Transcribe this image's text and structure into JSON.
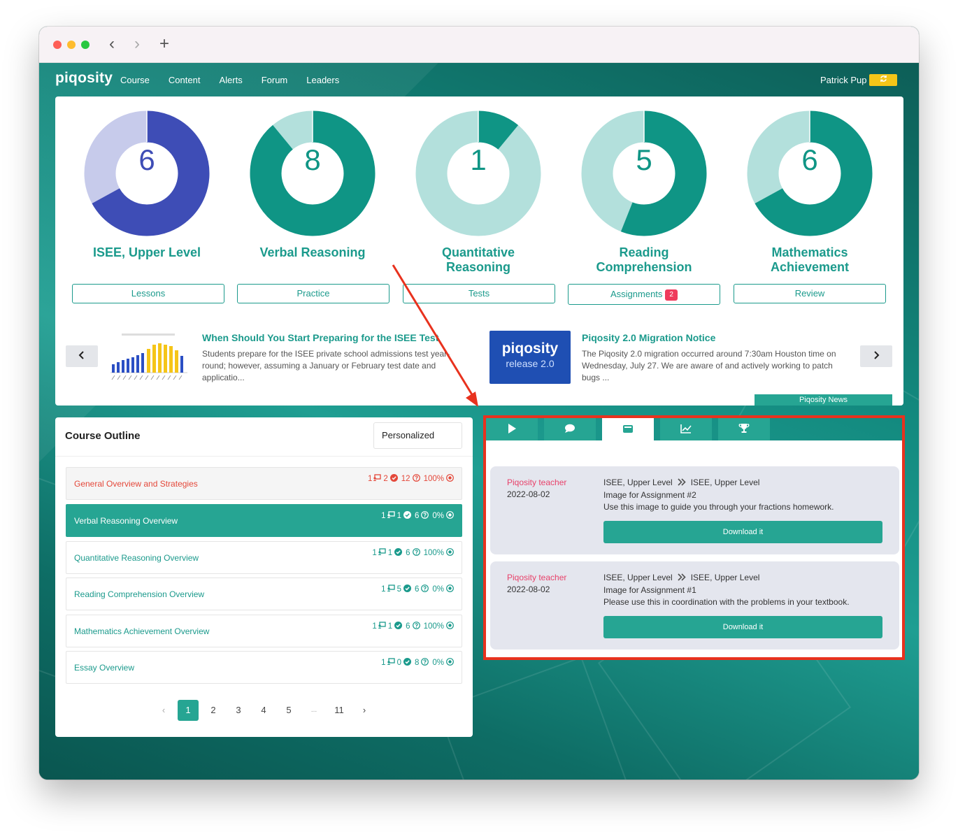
{
  "nav": {
    "logo": "piqosity",
    "links": [
      "Course",
      "Content",
      "Alerts",
      "Forum",
      "Leaders"
    ],
    "user": "Patrick Pup",
    "refresh_icon": "refresh-icon"
  },
  "donuts": [
    {
      "value": "6",
      "label_lines": [
        "ISEE, Upper Level",
        ""
      ],
      "fraction": 0.67,
      "main": "#3e4db6",
      "rest": "#c7cbeb"
    },
    {
      "value": "8",
      "label_lines": [
        "Verbal Reasoning",
        ""
      ],
      "fraction": 0.89,
      "main": "#0f9585",
      "rest": "#b3e0dc"
    },
    {
      "value": "1",
      "label_lines": [
        "Quantitative",
        "Reasoning"
      ],
      "fraction": 0.11,
      "main": "#0f9585",
      "rest": "#b3e0dc"
    },
    {
      "value": "5",
      "label_lines": [
        "Reading",
        "Comprehension"
      ],
      "fraction": 0.56,
      "main": "#0f9585",
      "rest": "#b3e0dc"
    },
    {
      "value": "6",
      "label_lines": [
        "Mathematics",
        "Achievement"
      ],
      "fraction": 0.67,
      "main": "#0f9585",
      "rest": "#b3e0dc"
    }
  ],
  "buttons": {
    "lessons": "Lessons",
    "practice": "Practice",
    "tests": "Tests",
    "assignments": "Assignments",
    "assignments_badge": "2",
    "review": "Review"
  },
  "news": [
    {
      "title": "When Should You Start Preparing for the ISEE Test",
      "text": "Students prepare for the ISEE private school admissions test year-round; however, assuming a January or February test date and applicatio..."
    },
    {
      "title": "Piqosity 2.0 Migration Notice",
      "text": "The Piqosity 2.0 migration occurred around 7:30am Houston time on Wednesday, July 27. We are aware of and actively working to patch bugs ...",
      "image_brand": "piqosity",
      "image_sub": "release 2.0"
    }
  ],
  "news_tab": "Piqosity News",
  "outline": {
    "heading": "Course Outline",
    "filter": "Personalized",
    "rows": [
      {
        "title": "General Overview and Strategies",
        "lessons": "1",
        "done": "2",
        "questions": "12",
        "pct": "100%",
        "style": "gray"
      },
      {
        "title": "Verbal Reasoning Overview",
        "lessons": "1",
        "done": "1",
        "questions": "6",
        "pct": "0%",
        "style": "active"
      },
      {
        "title": "Quantitative Reasoning Overview",
        "lessons": "1",
        "done": "1",
        "questions": "6",
        "pct": "100%",
        "style": "normal"
      },
      {
        "title": "Reading Comprehension Overview",
        "lessons": "1",
        "done": "5",
        "questions": "6",
        "pct": "0%",
        "style": "normal"
      },
      {
        "title": "Mathematics Achievement Overview",
        "lessons": "1",
        "done": "1",
        "questions": "6",
        "pct": "100%",
        "style": "normal"
      },
      {
        "title": "Essay Overview",
        "lessons": "1",
        "done": "0",
        "questions": "8",
        "pct": "0%",
        "style": "normal"
      }
    ],
    "pages": [
      "1",
      "2",
      "3",
      "4",
      "5",
      "...",
      "11"
    ],
    "current_page": "1"
  },
  "panel": {
    "tabs": [
      "play-icon",
      "comment-icon",
      "wallet-icon",
      "chart-icon",
      "trophy-icon"
    ],
    "active_tab": "wallet-icon",
    "assignments": [
      {
        "teacher": "Piqosity teacher",
        "date": "2022-08-02",
        "from": "ISEE, Upper Level",
        "to": "ISEE, Upper Level",
        "title": "Image for Assignment #2",
        "desc": "Use this image to guide you through your fractions homework.",
        "button": "Download it"
      },
      {
        "teacher": "Piqosity teacher",
        "date": "2022-08-02",
        "from": "ISEE, Upper Level",
        "to": "ISEE, Upper Level",
        "title": "Image for Assignment #1",
        "desc": "Please use this in coordination with the problems in your textbook.",
        "button": "Download it"
      }
    ]
  }
}
